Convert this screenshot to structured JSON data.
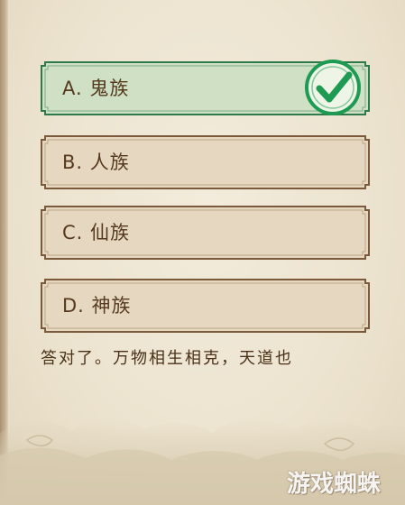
{
  "quiz": {
    "options": [
      {
        "label": "A. 鬼族",
        "state": "correct"
      },
      {
        "label": "B. 人族",
        "state": "default"
      },
      {
        "label": "C. 仙族",
        "state": "default"
      },
      {
        "label": "D. 神族",
        "state": "default"
      }
    ],
    "feedback": "答对了。万物相生相克，天道也"
  },
  "watermark": "游戏蜘蛛",
  "colors": {
    "background": "#ece3d1",
    "option_fill": "#e6d8c0",
    "option_border": "#7a5a3a",
    "correct_fill": "#cfe0c4",
    "correct_border": "#2f7a4a",
    "check_color": "#1f9a52",
    "text": "#55391f"
  },
  "icons": {
    "check": "check-mark-icon"
  }
}
